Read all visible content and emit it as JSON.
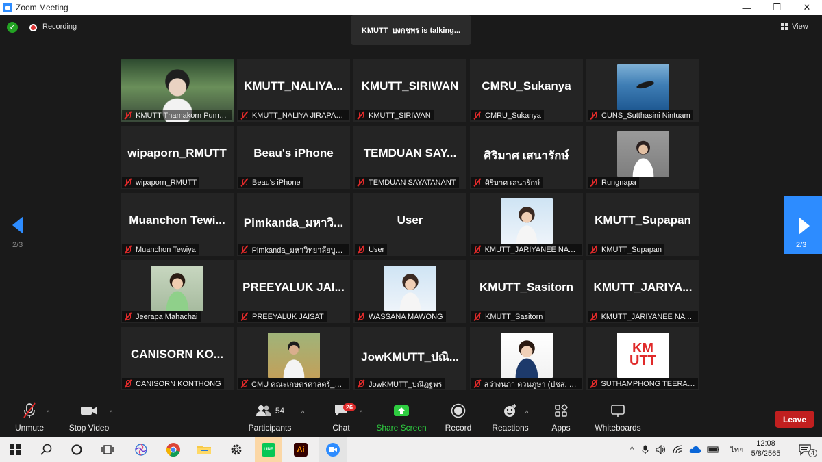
{
  "window": {
    "title": "Zoom Meeting",
    "minimize": "—",
    "maximize": "❐",
    "close": "✕"
  },
  "topbar": {
    "recording": "Recording",
    "talking": "KMUTT_บงกชพร is  talking...",
    "view": "View"
  },
  "pager": {
    "left": "2/3",
    "right": "2/3"
  },
  "tiles": [
    {
      "big": "",
      "label": "KMUTT Thamakorn Pump...",
      "photo": "video"
    },
    {
      "big": "KMUTT_NALIYA...",
      "label": "KMUTT_NALIYA JIRAPAK..."
    },
    {
      "big": "KMUTT_SIRIWAN",
      "label": "KMUTT_SIRIWAN"
    },
    {
      "big": "CMRU_Sukanya",
      "label": "CMRU_Sukanya"
    },
    {
      "big": "",
      "label": "CUNS_Sutthasini Nintuam",
      "photo": "sea"
    },
    {
      "big": "wipaporn_RMUTT",
      "label": "wipaporn_RMUTT"
    },
    {
      "big": "Beau's iPhone",
      "label": "Beau's iPhone"
    },
    {
      "big": "TEMDUAN  SAY...",
      "label": "TEMDUAN SAYATANANT"
    },
    {
      "big": "ศิริมาศ เสนารักษ์",
      "label": "ศิริมาศ เสนารักษ์"
    },
    {
      "big": "",
      "label": "Rungnapa",
      "photo": "person-grey"
    },
    {
      "big": "Muanchon  Tewi...",
      "label": "Muanchon Tewiya"
    },
    {
      "big": "Pimkanda_มหาวิ...",
      "label": "Pimkanda_มหาวิทยาลัยบูรพา"
    },
    {
      "big": "User",
      "label": "User"
    },
    {
      "big": "",
      "label": "KMUTT_JARIYANEE NATTA",
      "photo": "person-light"
    },
    {
      "big": "KMUTT_Supapan",
      "label": "KMUTT_Supapan"
    },
    {
      "big": "",
      "label": "Jeerapa Mahachai",
      "photo": "person-green"
    },
    {
      "big": "PREEYALUK  JAI...",
      "label": "PREEYALUK JAISAT"
    },
    {
      "big": "",
      "label": "WASSANA MAWONG",
      "photo": "person-light"
    },
    {
      "big": "KMUTT_Sasitorn",
      "label": "KMUTT_Sasitorn"
    },
    {
      "big": "KMUTT_JARIYA...",
      "label": "KMUTT_JARIYANEE NATTA"
    },
    {
      "big": "CANISORN  KO...",
      "label": "CANISORN KONTHONG"
    },
    {
      "big": "",
      "label": "CMU คณะเกษตรศาสตร์_ฐานิต",
      "photo": "person-field"
    },
    {
      "big": "JowKMUTT_ปณิ...",
      "label": "JowKMUTT_ปณิฏฐพร"
    },
    {
      "big": "",
      "label": "สว่างนภา ตวนภูษา (ปชส. มทร...",
      "photo": "person-blue"
    },
    {
      "big": "",
      "label": "SUTHAMPHONG TEERAN...",
      "photo": "logo"
    }
  ],
  "logo_text": "KM\nUTT",
  "toolbar": {
    "unmute": "Unmute",
    "stop_video": "Stop Video",
    "participants": "Participants",
    "participants_count": "54",
    "chat": "Chat",
    "chat_badge": "26",
    "share": "Share Screen",
    "record": "Record",
    "reactions": "Reactions",
    "apps": "Apps",
    "whiteboards": "Whiteboards",
    "leave": "Leave"
  },
  "taskbar": {
    "lang": "ไทย",
    "time": "12:08",
    "date": "5/8/2565",
    "notif_count": "4"
  },
  "colors": {
    "accent": "#2D8CFF",
    "leave": "#C11F1F",
    "share": "#2ECC40",
    "muted": "#E02A2A"
  }
}
